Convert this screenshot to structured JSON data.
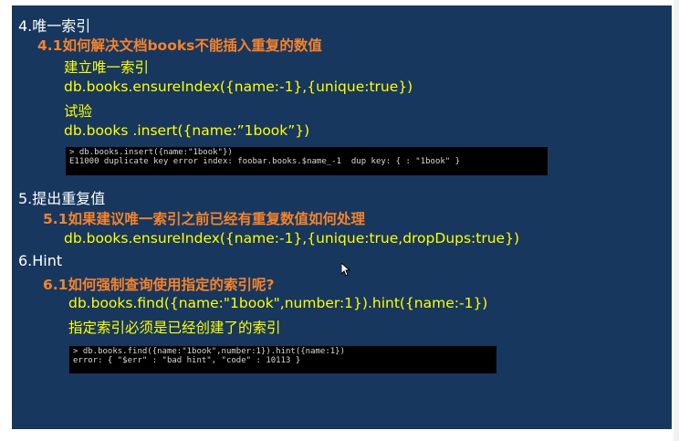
{
  "sections": [
    {
      "heading": "4.唯一索引"
    },
    {
      "sub": "4.1如何解决文档books不能插入重复的数值"
    },
    {
      "l1": "建立唯一索引",
      "l2": "db.books.ensureIndex({name:-1},{unique:true})",
      "l3": "试验",
      "l4": "db.books .insert({name:”1book”})"
    },
    {
      "heading": "5.提出重复值"
    },
    {
      "sub": "5.1如果建议唯一索引之前已经有重复数值如何处理"
    },
    {
      "l1": "db.books.ensureIndex({name:-1},{unique:true,dropDups:true})"
    },
    {
      "heading": "6.Hint"
    },
    {
      "sub": "6.1如何强制查询使用指定的索引呢?"
    },
    {
      "l1": "db.books.find({name:\"1book\",number:1}).hint({name:-1})",
      "l2": "指定索引必须是已经创建了的索引"
    }
  ],
  "terminal1": {
    "line1": "> db.books.insert({name:\"1book\"})",
    "line2": "E11000 duplicate key error index: foobar.books.$name_-1  dup key: { : \"1book\" }"
  },
  "terminal2": {
    "line1": "> db.books.find({name:\"1book\",number:1}).hint({name:1})",
    "line2": "error: { \"$err\" : \"bad hint\", \"code\" : 10113 }"
  },
  "colors": {
    "slide_bg": "#17375e",
    "heading": "#ffffff",
    "subheading": "#f5832a",
    "body": "#ffff00"
  }
}
